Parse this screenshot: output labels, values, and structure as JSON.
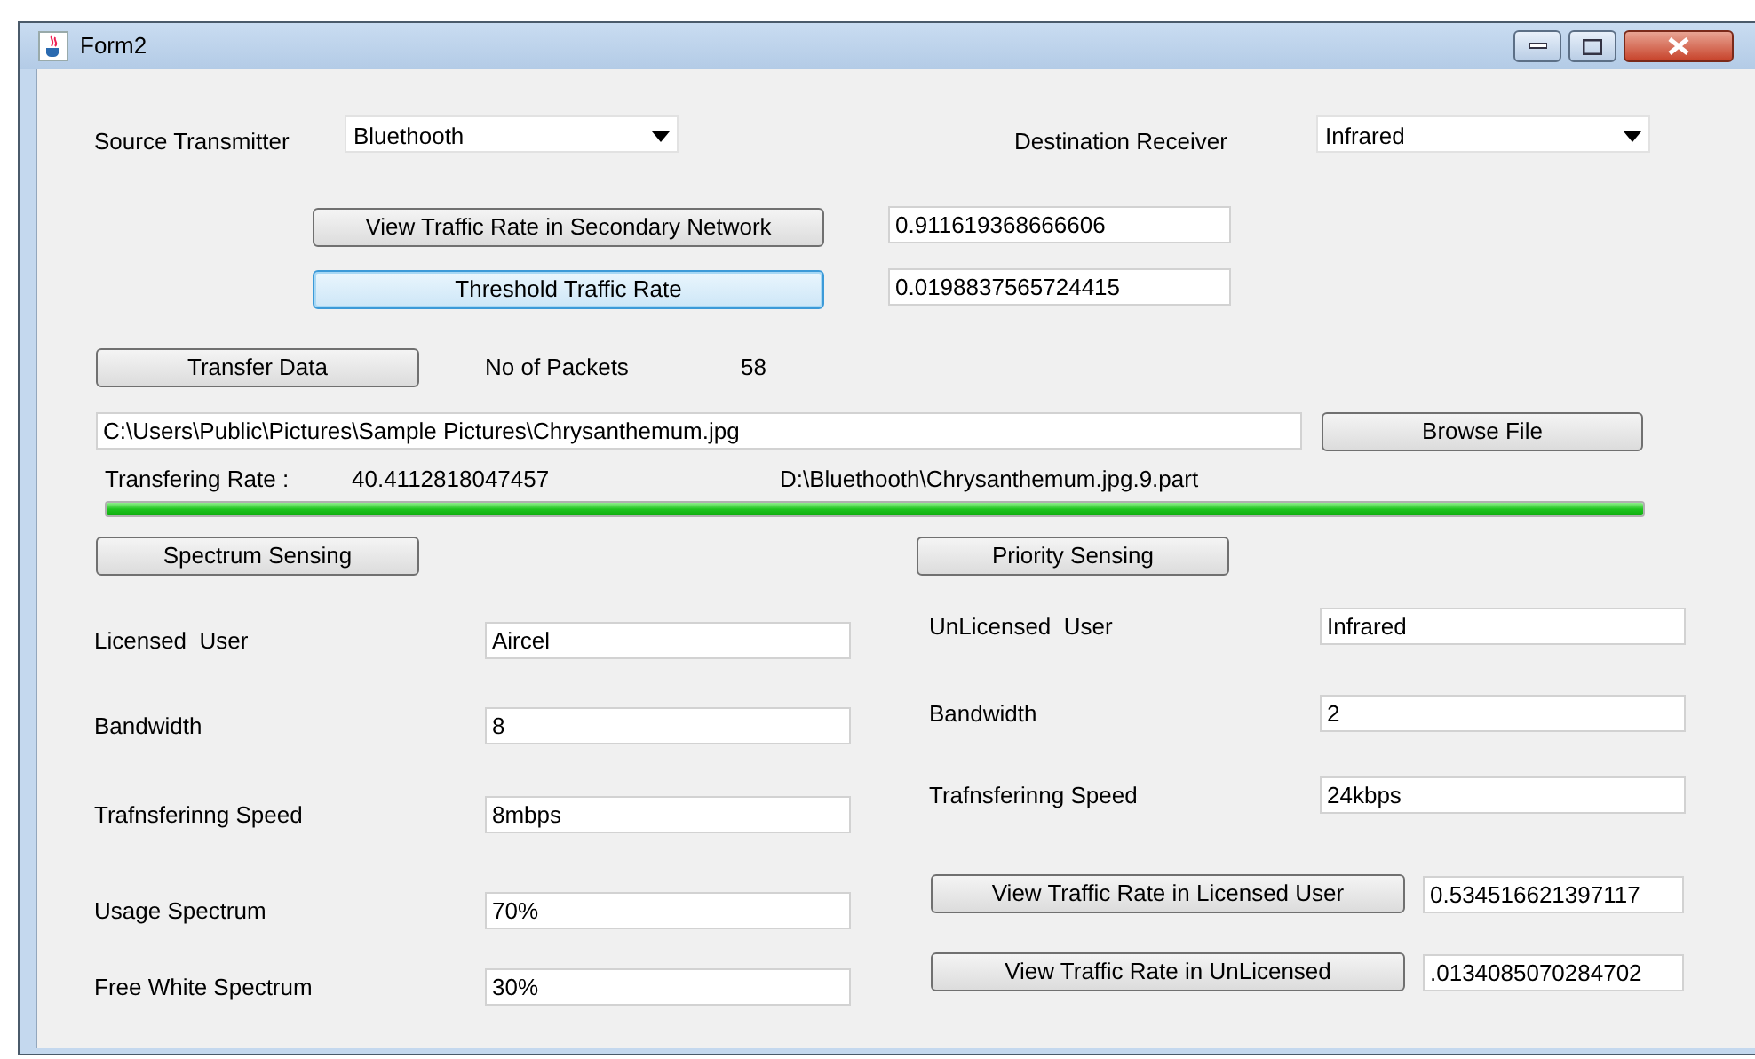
{
  "window": {
    "title": "Form2"
  },
  "source": {
    "label": "Source Transmitter",
    "value": "Bluethooth"
  },
  "destination": {
    "label": "Destination Receiver",
    "value": "Infrared"
  },
  "rates": [
    {
      "button": "View Traffic Rate in Secondary Network",
      "value": "0.911619368666606",
      "focused": false
    },
    {
      "button": "Threshold Traffic Rate",
      "value": "0.0198837565724415",
      "focused": true
    }
  ],
  "transfer": {
    "button": "Transfer Data",
    "packets_label": "No of Packets",
    "packets": "58"
  },
  "file": {
    "path": "C:\\Users\\Public\\Pictures\\Sample Pictures\\Chrysanthemum.jpg",
    "button": "Browse File"
  },
  "progress": {
    "rate_label": "Transfering Rate :",
    "rate": "40.4112818047457",
    "target": "D:\\Bluethooth\\Chrysanthemum.jpg.9.part",
    "level": 1
  },
  "licensed": {
    "button": "Spectrum Sensing",
    "fields": [
      {
        "label": "Licensed  User",
        "value": "Aircel"
      },
      {
        "label": "Bandwidth",
        "value": "8"
      },
      {
        "label": "Trafnsferinng Speed",
        "value": "8mbps"
      },
      {
        "label": "Usage Spectrum",
        "value": "70%"
      },
      {
        "label": "Free White Spectrum",
        "value": "30%"
      }
    ]
  },
  "unlicensed": {
    "button": "Priority Sensing",
    "fields": [
      {
        "label": "UnLicensed  User",
        "value": "Infrared"
      },
      {
        "label": "Bandwidth",
        "value": "2"
      },
      {
        "label": "Trafnsferinng Speed",
        "value": "24kbps"
      }
    ],
    "rates": [
      {
        "button": "View Traffic Rate in Licensed User",
        "value": "0.534516621397117"
      },
      {
        "button": "View Traffic Rate in UnLicensed",
        "value": ".0134085070284702"
      }
    ]
  }
}
